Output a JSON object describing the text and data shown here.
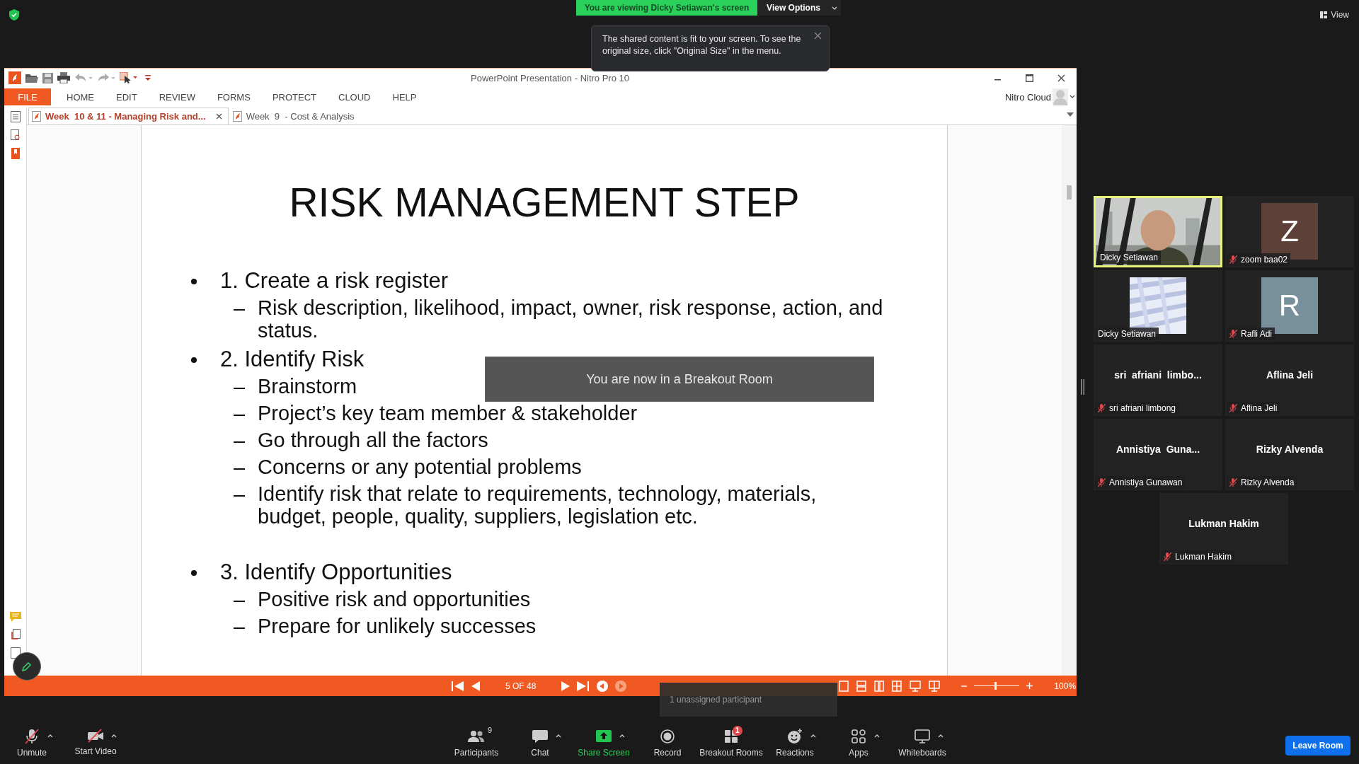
{
  "top": {
    "banner": "You are viewing Dicky Setiawan's screen",
    "view_options": "View Options",
    "view": "View"
  },
  "tooltip": {
    "text": "The shared content is fit to your screen. To see the original size, click \"Original Size\" in the menu."
  },
  "nitro": {
    "title": "PowerPoint Presentation - Nitro Pro 10",
    "menu": [
      {
        "label": "FILE",
        "selected": true
      },
      {
        "label": "HOME",
        "selected": false
      },
      {
        "label": "EDIT",
        "selected": false
      },
      {
        "label": "REVIEW",
        "selected": false
      },
      {
        "label": "FORMS",
        "selected": false
      },
      {
        "label": "PROTECT",
        "selected": false
      },
      {
        "label": "CLOUD",
        "selected": false
      },
      {
        "label": "HELP",
        "selected": false
      }
    ],
    "account": "Nitro Cloud",
    "tabs": [
      {
        "label": "Week  10 & 11 - Managing Risk and...",
        "selected": true
      },
      {
        "label": "Week  9  - Cost & Analysis",
        "selected": false
      }
    ],
    "slide": {
      "title": "RISK MANAGEMENT STEP",
      "items": [
        {
          "text": "1. Create a risk register",
          "children": [
            {
              "text": "Risk description, likelihood, impact, owner, risk response, action, and status."
            }
          ]
        },
        {
          "text": "2. Identify Risk",
          "children": [
            {
              "text": "Brainstorm"
            },
            {
              "text": "Project’s key team member & stakeholder"
            },
            {
              "text": "Go through all the factors"
            },
            {
              "text": "Concerns or any potential problems"
            },
            {
              "text": "Identify risk that relate to requirements, technology, materials, budget, people, quality, suppliers, legislation etc."
            }
          ]
        },
        {
          "text": "3. Identify Opportunities",
          "children": [
            {
              "text": "Positive risk and opportunities"
            },
            {
              "text": "Prepare for unlikely successes"
            }
          ]
        }
      ]
    },
    "page": "5 OF 48",
    "zoom": "100%",
    "zoom_slider": {
      "level": 0.47
    }
  },
  "breakout_notice": "You are now in a Breakout Room",
  "unassigned": "1 unassigned participant",
  "participants": [
    {
      "kind": "video",
      "name": "Dicky Setiawan",
      "muted": false,
      "speaking": true
    },
    {
      "kind": "avatar",
      "initial": "Z",
      "color": "#5d4037",
      "name": "zoom baa02",
      "muted": true,
      "speaking": false
    },
    {
      "kind": "screen",
      "name": "Dicky Setiawan",
      "muted": false,
      "speaking": false
    },
    {
      "kind": "avatar",
      "initial": "R",
      "color": "#78909c",
      "name": "Rafli Adi",
      "muted": true,
      "speaking": false
    },
    {
      "kind": "name",
      "display": "sri  afriani  limbo...",
      "name": "sri afriani limbong",
      "muted": true,
      "speaking": false
    },
    {
      "kind": "name",
      "display": "Aflina Jeli",
      "name": "Aflina Jeli",
      "muted": true,
      "speaking": false
    },
    {
      "kind": "name",
      "display": "Annistiya  Guna...",
      "name": "Annistiya Gunawan",
      "muted": true,
      "speaking": false
    },
    {
      "kind": "name",
      "display": "Rizky Alvenda",
      "name": "Rizky Alvenda",
      "muted": true,
      "speaking": false
    },
    {
      "kind": "name",
      "display": "Lukman Hakim",
      "name": "Lukman Hakim",
      "muted": true,
      "speaking": false
    }
  ],
  "toolbar": {
    "left": [
      {
        "label": "Unmute",
        "kind": "mic",
        "caret": true
      },
      {
        "label": "Start Video",
        "kind": "video",
        "caret": true
      }
    ],
    "center": [
      {
        "label": "Participants",
        "kind": "participants",
        "count": "9",
        "caret": false
      },
      {
        "label": "Chat",
        "kind": "chat",
        "caret": true
      },
      {
        "label": "Share Screen",
        "kind": "share",
        "caret": true
      },
      {
        "label": "Record",
        "kind": "record",
        "caret": false
      },
      {
        "label": "Breakout Rooms",
        "kind": "breakout",
        "badge": "1",
        "caret": false
      },
      {
        "label": "Reactions",
        "kind": "reactions",
        "caret": true
      },
      {
        "label": "Apps",
        "kind": "apps",
        "caret": true
      },
      {
        "label": "Whiteboards",
        "kind": "whiteboards",
        "caret": true
      }
    ],
    "leave": "Leave Room"
  }
}
